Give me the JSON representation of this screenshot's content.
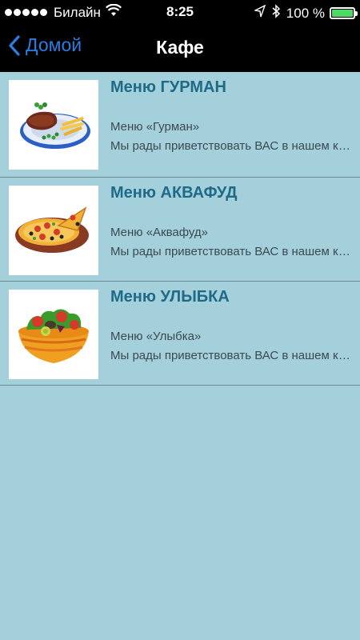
{
  "status_bar": {
    "carrier": "Билайн",
    "time": "8:25",
    "battery_percent": "100 %",
    "battery_level": 1.0,
    "signal_bars": 5,
    "icons": [
      "wifi-icon",
      "location-arrow-icon",
      "bluetooth-icon",
      "battery-icon"
    ]
  },
  "nav": {
    "back_label": "Домой",
    "title": "Кафе",
    "accent_color": "#2a7de1"
  },
  "items": [
    {
      "title": "Меню ГУРМАН",
      "subtitle": "Меню «Гурман»",
      "description": "Мы рады приветствовать ВАС в нашем кафе",
      "image": "steak-plate-image"
    },
    {
      "title": "Меню АКВАФУД",
      "subtitle": "Меню «Аквафуд»",
      "description": "Мы рады приветствовать ВАС в нашем кафе",
      "image": "pizza-image"
    },
    {
      "title": "Меню УЛЫБКА",
      "subtitle": "Меню «Улыбка»",
      "description": "Мы рады приветствовать ВАС в нашем кафе",
      "image": "salad-bowl-image"
    }
  ],
  "colors": {
    "background": "#a4d0dc",
    "title_text": "#1f6a86",
    "body_text": "#3c4a50"
  }
}
